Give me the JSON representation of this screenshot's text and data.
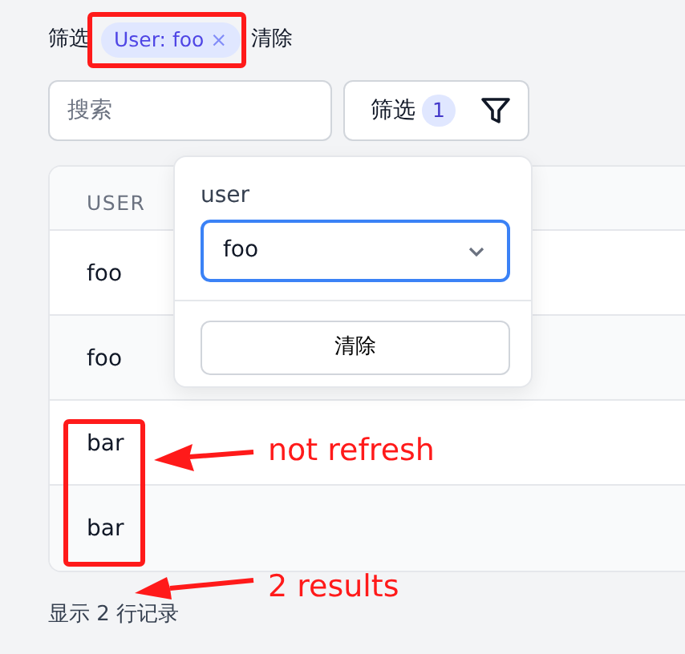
{
  "filter_bar": {
    "label": "筛选",
    "chips": [
      {
        "text": "User: foo",
        "remove": "×"
      }
    ],
    "clear": "清除"
  },
  "search": {
    "placeholder": "搜索"
  },
  "filter_button": {
    "label": "筛选",
    "count": "1"
  },
  "table": {
    "columns": [
      "USER"
    ],
    "rows": [
      [
        "foo"
      ],
      [
        "foo"
      ],
      [
        "bar"
      ],
      [
        "bar"
      ]
    ]
  },
  "popover": {
    "field_label": "user",
    "select_value": "foo",
    "clear_button": "清除"
  },
  "footer": "显示 2 行记录",
  "annotations": [
    {
      "text": "not refresh"
    },
    {
      "text": "2 results"
    }
  ]
}
